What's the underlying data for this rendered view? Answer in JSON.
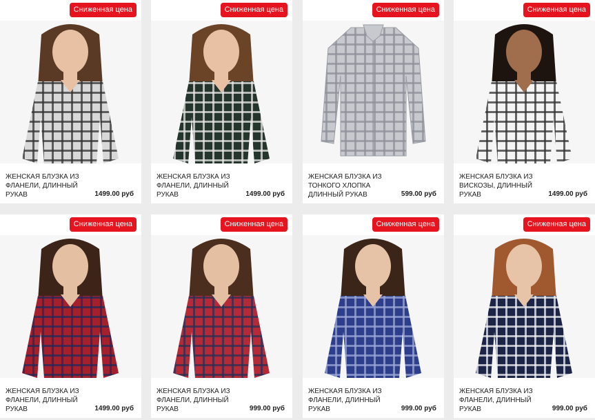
{
  "products": [
    {
      "badge": "Сниженная цена",
      "title": "ЖЕНСКАЯ БЛУЗКА ИЗ ФЛАНЕЛИ, ДЛИННЫЙ РУКАВ",
      "price": "1499.00 руб",
      "colors": {
        "shirt": "#d8d8d8",
        "check": "#333333",
        "skin": "#e8c1a5",
        "hair": "#5a3a24"
      }
    },
    {
      "badge": "Сниженная цена",
      "title": "ЖЕНСКАЯ БЛУЗКА ИЗ ФЛАНЕЛИ, ДЛИННЫЙ РУКАВ",
      "price": "1499.00 руб",
      "colors": {
        "shirt": "#24362c",
        "check": "#e6e6e6",
        "skin": "#e8c1a5",
        "hair": "#6b4428"
      }
    },
    {
      "badge": "Сниженная цена",
      "title": "ЖЕНСКАЯ БЛУЗКА ИЗ ТОНКОГО ХЛОПКА ДЛИННЫЙ РУКАВ",
      "price": "599.00 руб",
      "colors": {
        "shirt": "#c7c9cf",
        "check": "#8e9199",
        "skin": "",
        "hair": ""
      }
    },
    {
      "badge": "Сниженная цена",
      "title": "ЖЕНСКАЯ БЛУЗКА ИЗ ВИСКОЗЫ, ДЛИННЫЙ РУКАВ",
      "price": "1499.00 руб",
      "colors": {
        "shirt": "#f4f4f4",
        "check": "#333333",
        "skin": "#a06e4c",
        "hair": "#1d1410"
      }
    },
    {
      "badge": "Сниженная цена",
      "title": "ЖЕНСКАЯ БЛУЗКА ИЗ ФЛАНЕЛИ, ДЛИННЫЙ РУКАВ",
      "price": "1499.00 руб",
      "colors": {
        "shirt": "#a5202d",
        "check": "#1f2a59",
        "skin": "#e5bfa1",
        "hair": "#3c2518"
      }
    },
    {
      "badge": "Сниженная цена",
      "title": "ЖЕНСКАЯ БЛУЗКА ИЗ ФЛАНЕЛИ, ДЛИННЫЙ РУКАВ",
      "price": "999.00 руб",
      "colors": {
        "shirt": "#b52a36",
        "check": "#2b2f52",
        "skin": "#e5bfa1",
        "hair": "#4b2e1d"
      }
    },
    {
      "badge": "Сниженная цена",
      "title": "ЖЕНСКАЯ БЛУЗКА ИЗ ФЛАНЕЛИ, ДЛИННЫЙ РУКАВ",
      "price": "999.00 руб",
      "colors": {
        "shirt": "#2d3f8c",
        "check": "#9aa6d6",
        "skin": "#e6c2a6",
        "hair": "#3b2418"
      }
    },
    {
      "badge": "Сниженная цена",
      "title": "ЖЕНСКАЯ БЛУЗКА ИЗ ФЛАНЕЛИ, ДЛИННЫЙ РУКАВ",
      "price": "999.00 руб",
      "colors": {
        "shirt": "#1d2547",
        "check": "#f0f0f0",
        "skin": "#e7c3a8",
        "hair": "#a0582e"
      }
    }
  ]
}
